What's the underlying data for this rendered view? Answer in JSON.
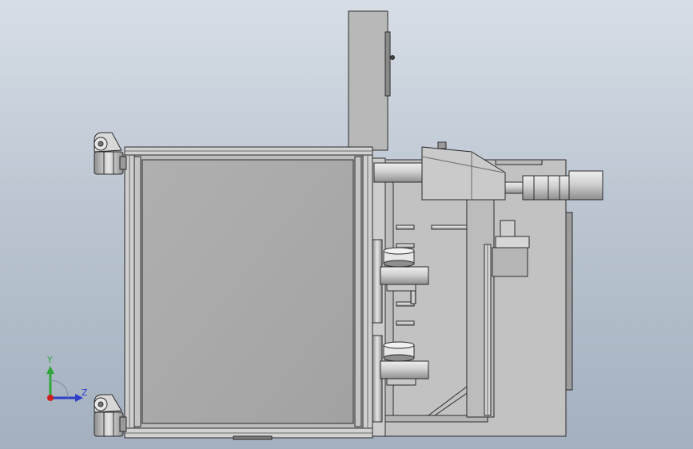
{
  "viewport": {
    "background_top": "#d7dee6",
    "background_bottom": "#a4b0bf"
  },
  "model": {
    "metal_color": "#c8c8c8",
    "frame_color": "#b9b9b9",
    "panel_color": "#aaaaaa",
    "edge_color": "#2a2a2a"
  },
  "triad": {
    "y_label": "Y",
    "z_label": "Z",
    "y_color": "#2fa63a",
    "z_color": "#2f3fc8",
    "x_color": "#d02020"
  }
}
